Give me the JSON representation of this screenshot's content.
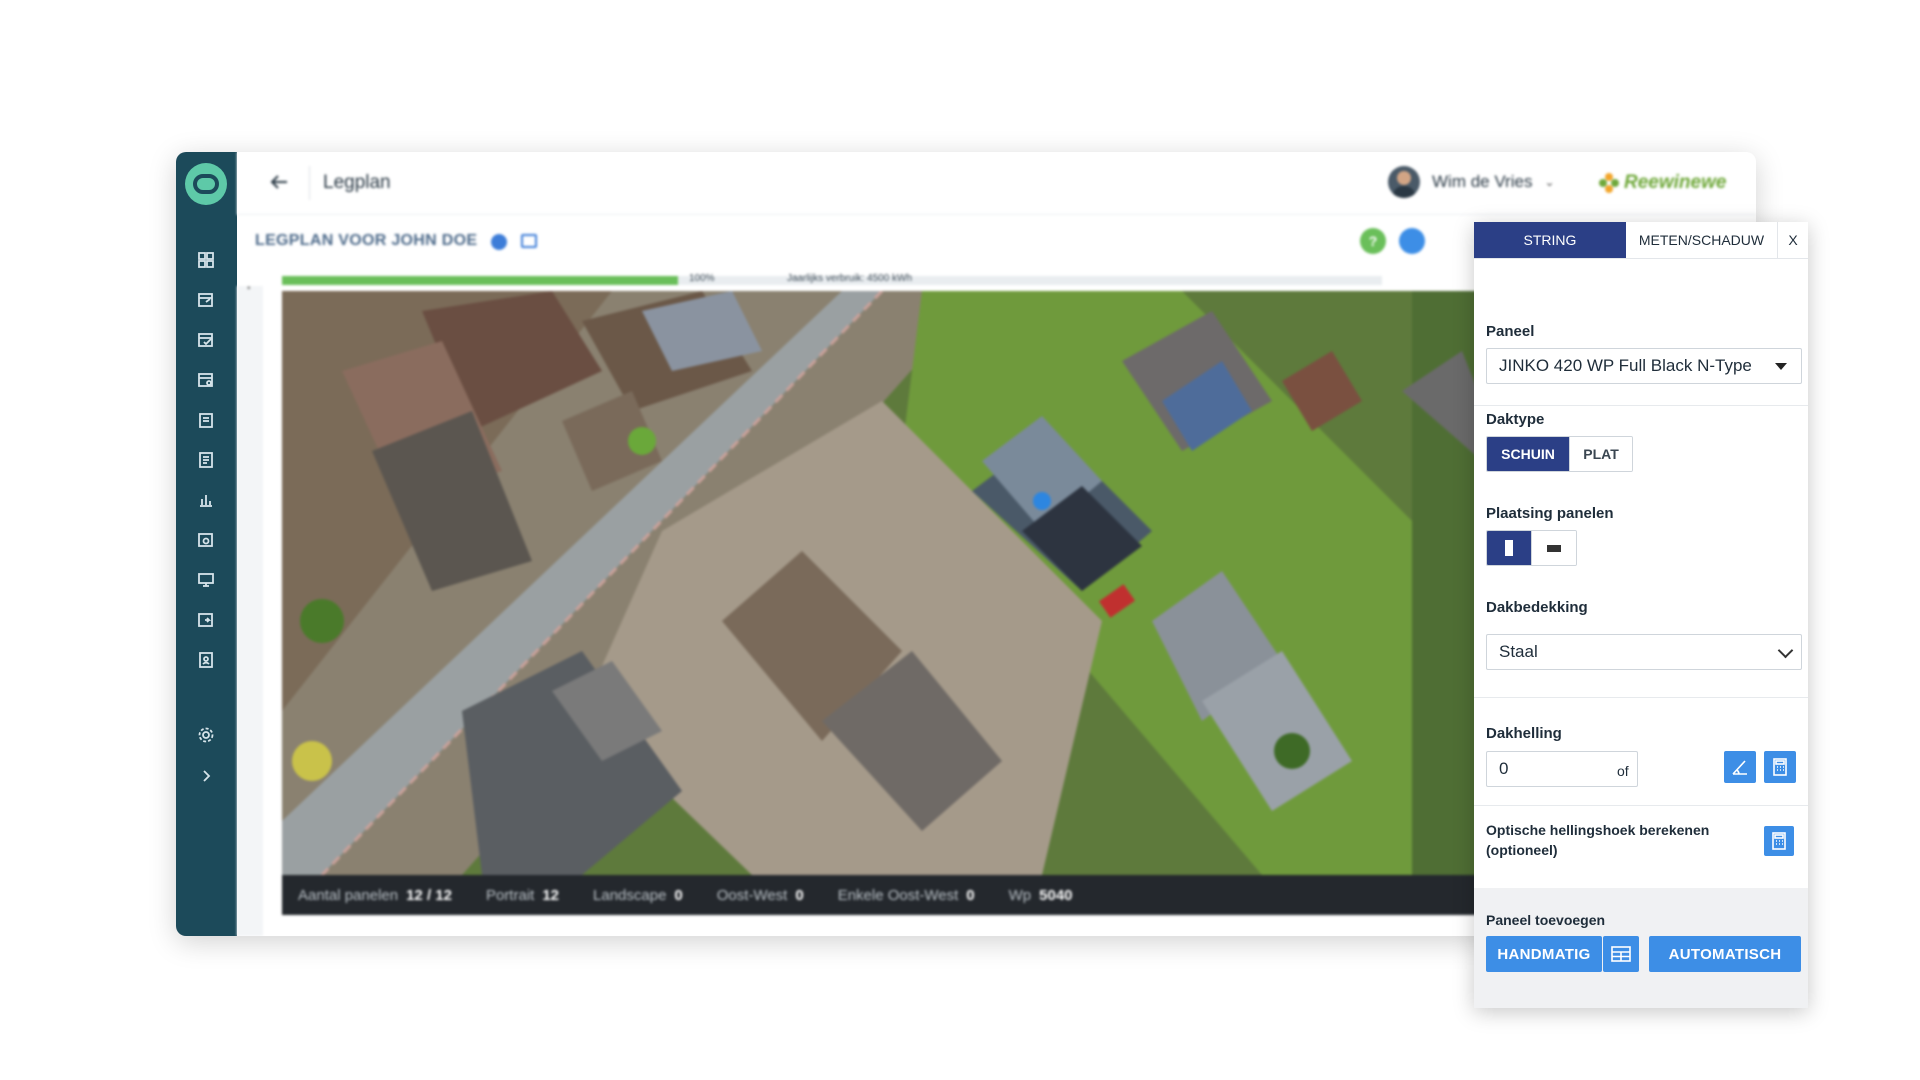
{
  "header": {
    "title": "Legplan",
    "user_name": "Wim de Vries",
    "brand": "Reewinewe"
  },
  "subheader": {
    "title": "LEGPLAN VOOR JOHN DOE"
  },
  "progress": {
    "percent_label": "100%",
    "fraction": 0.36,
    "usage_label": "Jaarlijks verbruik: 4500 kWh"
  },
  "statusbar": {
    "items": [
      {
        "key": "Aantal panelen",
        "value": "12 / 12"
      },
      {
        "key": "Portrait",
        "value": "12"
      },
      {
        "key": "Landscape",
        "value": "0"
      },
      {
        "key": "Oost-West",
        "value": "0"
      },
      {
        "key": "Enkele Oost-West",
        "value": "0"
      },
      {
        "key": "Wp",
        "value": "5040"
      }
    ]
  },
  "panel": {
    "tabs": [
      "STRING",
      "METEN/SCHADUW",
      "X"
    ],
    "paneel_label": "Paneel",
    "paneel_value": "JINKO 420 WP Full Black N-Type",
    "daktype_label": "Daktype",
    "daktype_options": [
      "SCHUIN",
      "PLAT"
    ],
    "plaatsing_label": "Plaatsing panelen",
    "dakbedekking_label": "Dakbedekking",
    "dakbedekking_value": "Staal",
    "dakhelling_label": "Dakhelling",
    "dakhelling_value": "0",
    "of_label": "of",
    "optisch_label_1": "Optische hellingshoek berekenen",
    "optisch_label_2": "(optioneel)",
    "toevoegen_label": "Paneel toevoegen",
    "handmatig_label": "HANDMATIG",
    "automatisch_label": "AUTOMATISCH"
  },
  "colors": {
    "sidebar": "#1c4a5a",
    "accent": "#3d8ee6",
    "active_tab": "#2b3f86",
    "progress": "#6abf5a"
  }
}
